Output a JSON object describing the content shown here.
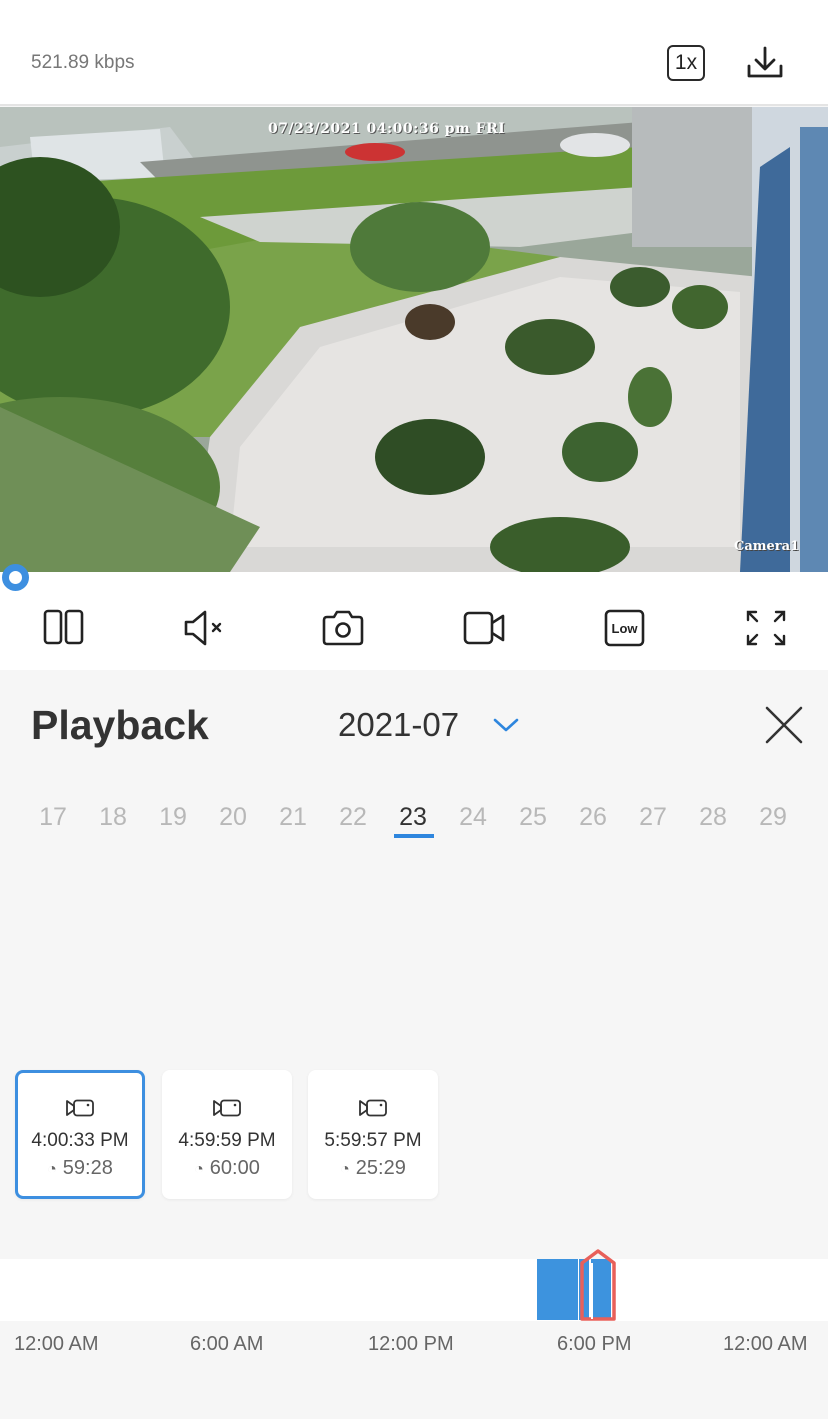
{
  "topbar": {
    "bitrate": "521.89 kbps",
    "speed_label": "1x",
    "download_icon": "download-icon"
  },
  "video": {
    "osd_timestamp": "07/23/2021 04:00:36 pm FRI",
    "camera_label": "Camera1"
  },
  "controls": [
    {
      "name": "split-view-icon"
    },
    {
      "name": "mute-icon"
    },
    {
      "name": "snapshot-icon"
    },
    {
      "name": "record-icon"
    },
    {
      "name": "quality-icon",
      "label": "Low"
    },
    {
      "name": "fullscreen-icon"
    }
  ],
  "playback": {
    "title": "Playback",
    "month": "2021-07",
    "days": [
      "17",
      "18",
      "19",
      "20",
      "21",
      "22",
      "23",
      "24",
      "25",
      "26",
      "27",
      "28",
      "29"
    ],
    "selected_day": "23"
  },
  "recordings": [
    {
      "start": "4:00:33 PM",
      "duration": "59:28",
      "selected": true
    },
    {
      "start": "4:59:59 PM",
      "duration": "60:00",
      "selected": false
    },
    {
      "start": "5:59:57 PM",
      "duration": "25:29",
      "selected": false
    }
  ],
  "timeline": {
    "labels": [
      "12:00 AM",
      "6:00 AM",
      "12:00 PM",
      "6:00 PM",
      "12:00 AM"
    ]
  },
  "colors": {
    "accent": "#3d8fe0",
    "cursor": "#e8605a"
  }
}
